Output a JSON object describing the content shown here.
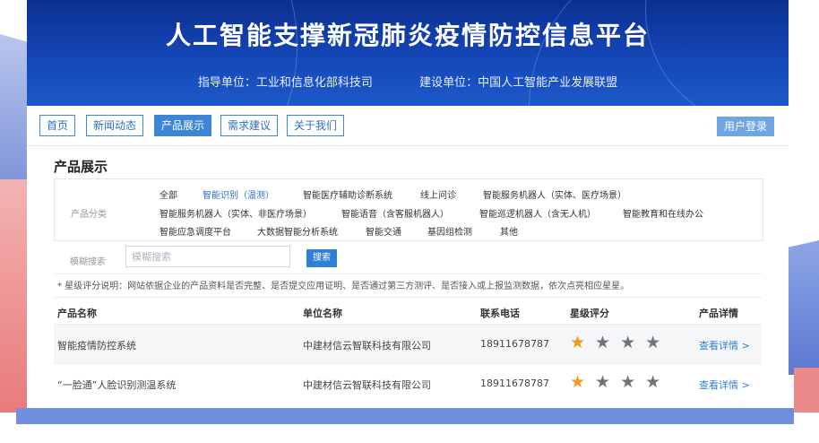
{
  "banner": {
    "title": "人工智能支撑新冠肺炎疫情防控信息平台",
    "guide_unit": "指导单位：工业和信息化部科技司",
    "build_unit": "建设单位：中国人工智能产业发展联盟"
  },
  "nav": {
    "tabs": [
      {
        "label": "首页"
      },
      {
        "label": "新闻动态"
      },
      {
        "label": "产品展示"
      },
      {
        "label": "需求建议"
      },
      {
        "label": "关于我们"
      }
    ],
    "active_tab": "产品展示",
    "login_label": "用户登录"
  },
  "page_title": "产品展示",
  "filter": {
    "label": "产品分类",
    "categories": [
      {
        "label": "全部"
      },
      {
        "label": "智能识别（温测）"
      },
      {
        "label": "智能医疗辅助诊断系统"
      },
      {
        "label": "线上问诊"
      },
      {
        "label": "智能服务机器人（实体、医疗场景）"
      },
      {
        "label": "智能服务机器人（实体、非医疗场景）"
      },
      {
        "label": "智能语音（含客服机器人）"
      },
      {
        "label": "智能巡逻机器人（含无人机）"
      },
      {
        "label": "智能教育和在线办公"
      },
      {
        "label": "智能应急调度平台"
      },
      {
        "label": "大数据智能分析系统"
      },
      {
        "label": "智能交通"
      },
      {
        "label": "基因组检测"
      },
      {
        "label": "其他"
      }
    ],
    "active_category": "智能识别（温测）"
  },
  "search": {
    "label": "模糊搜索",
    "value": "",
    "placeholder": "模糊搜索",
    "button_label": "搜索"
  },
  "note": "* 星级评分说明：网站依据企业的产品资料是否完整、是否提交应用证明、是否通过第三方测评、是否接入或上报监测数据，依次点亮相应星星。",
  "table": {
    "columns": [
      "产品名称",
      "单位名称",
      "联系电话",
      "星级评分",
      "产品详情"
    ],
    "rows": [
      {
        "name": "智能疫情防控系统",
        "company": "中建材信云智联科技有限公司",
        "phone": "18911678787",
        "rating": 1,
        "detail": "查看详情 >"
      },
      {
        "name": "“一脸通”人脸识别测温系统",
        "company": "中建材信云智联科技有限公司",
        "phone": "18911678787",
        "rating": 1,
        "detail": "查看详情 >"
      }
    ],
    "max_stars": 4
  },
  "colors": {
    "banner": "#1547b8",
    "accent": "#3d86d6",
    "star_on": "#f39a1e",
    "star_off": "#6f737a"
  }
}
